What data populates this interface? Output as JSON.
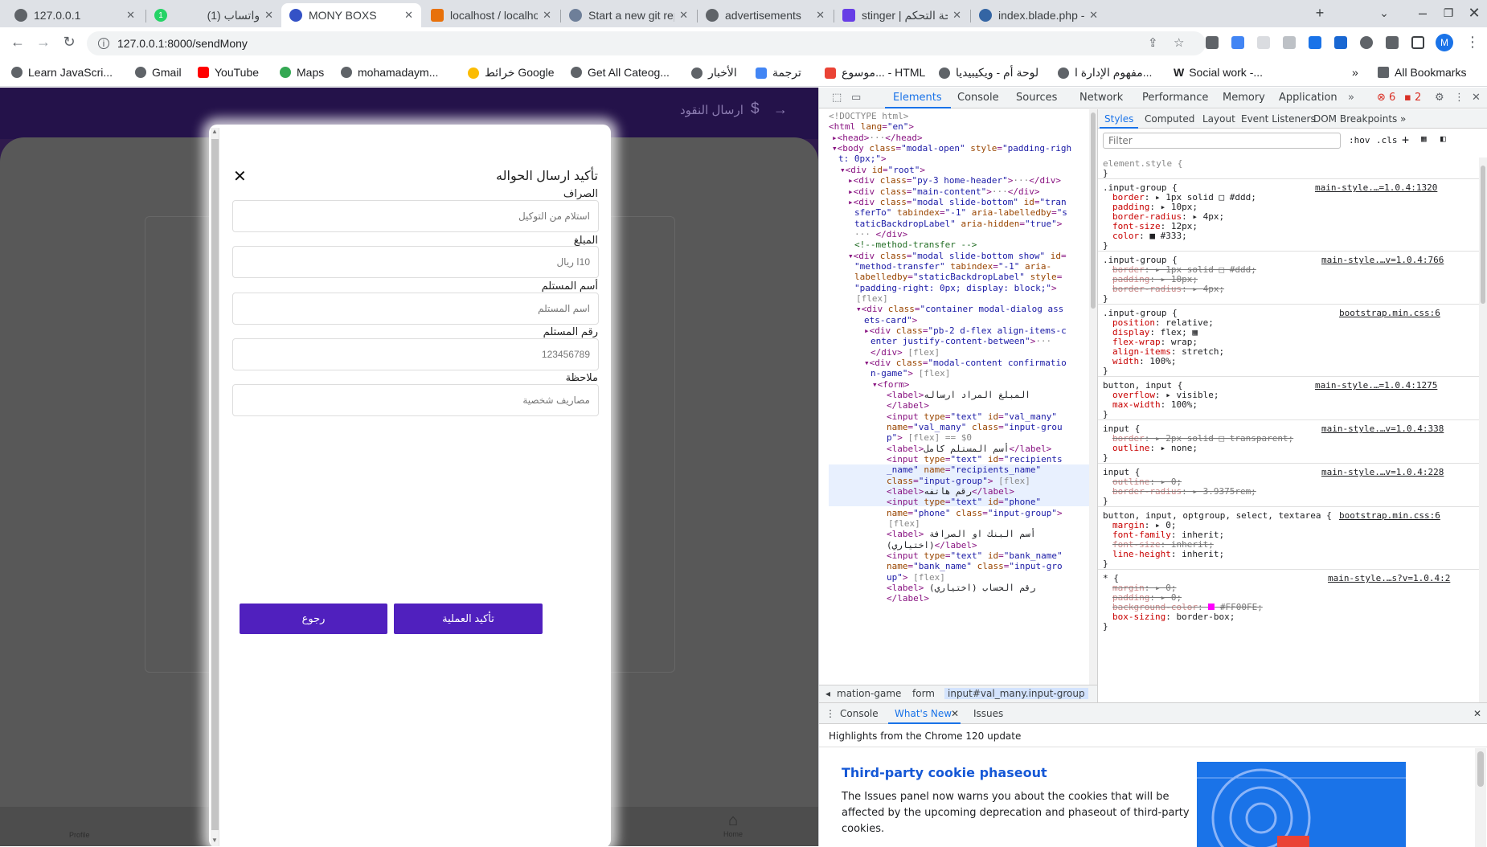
{
  "browser": {
    "tabs": [
      {
        "title": "127.0.0.1",
        "favicon": "globe-icon",
        "active": false
      },
      {
        "title": "(1) واتساب",
        "favicon": "whatsapp-icon",
        "active": false
      },
      {
        "title": "MONY BOXS",
        "favicon": "site-icon",
        "active": true
      },
      {
        "title": "localhost / localhos",
        "favicon": "phpmyadmin-icon",
        "active": false
      },
      {
        "title": "Start a new git repo",
        "favicon": "git-icon",
        "active": false
      },
      {
        "title": "advertisements",
        "favicon": "globe-icon",
        "active": false
      },
      {
        "title": "stinger | لوحة التحكم",
        "favicon": "hostinger-icon",
        "active": false
      },
      {
        "title": "index.blade.php - c",
        "favicon": "vscode-icon",
        "active": false
      }
    ],
    "url": "127.0.0.1:8000/sendMony",
    "avatar_letter": "M",
    "bookmarks": [
      "Learn JavaScri...",
      "Gmail",
      "YouTube",
      "Maps",
      "mohamadaym...",
      "خرائط Google",
      "Get All Cateog...",
      "الأخبار",
      "ترجمة",
      "موسوع... - HTML",
      "لوحة أم - ويكيبيديا",
      "مفهوم الإدارة ا...",
      "Social work -...",
      "All Bookmarks"
    ]
  },
  "app": {
    "header_title": "ارسال النقود",
    "bottom_nav": {
      "home": "Home",
      "profile": "Profile"
    }
  },
  "modal": {
    "title": "تأكيد ارسال الحواله",
    "fields": [
      {
        "label": "الصراف",
        "value": "استلام من التوكيل"
      },
      {
        "label": "المبلغ",
        "value": "10ا ريال"
      },
      {
        "label": "أسم المستلم",
        "value": "اسم المستلم"
      },
      {
        "label": "رقم المستلم",
        "value": "123456789"
      },
      {
        "label": "ملاحظة",
        "value": "مصاريف شخصية"
      }
    ],
    "confirm_label": "تأكيد العملية",
    "back_label": "رجوع",
    "button_color": "#5020be"
  },
  "devtools": {
    "tabs": [
      "Elements",
      "Console",
      "Sources",
      "Network",
      "Performance",
      "Memory",
      "Application"
    ],
    "errors": "6",
    "warnings": "2",
    "styles_tabs": [
      "Styles",
      "Computed",
      "Layout",
      "Event Listeners",
      "DOM Breakpoints"
    ],
    "filter_placeholder": "Filter",
    "hov": ":hov",
    "cls": ".cls",
    "breadcrumb": [
      "mation-game",
      "form",
      "input#val_many.input-group"
    ],
    "drawer_tabs": [
      "Console",
      "What's New",
      "Issues"
    ],
    "drawer_head": "Highlights from the Chrome 120 update",
    "drawer_title": "Third-party cookie phaseout",
    "drawer_text": "The Issues panel now warns you about the cookies that will be affected by the upcoming deprecation and phaseout of third-party cookies."
  }
}
